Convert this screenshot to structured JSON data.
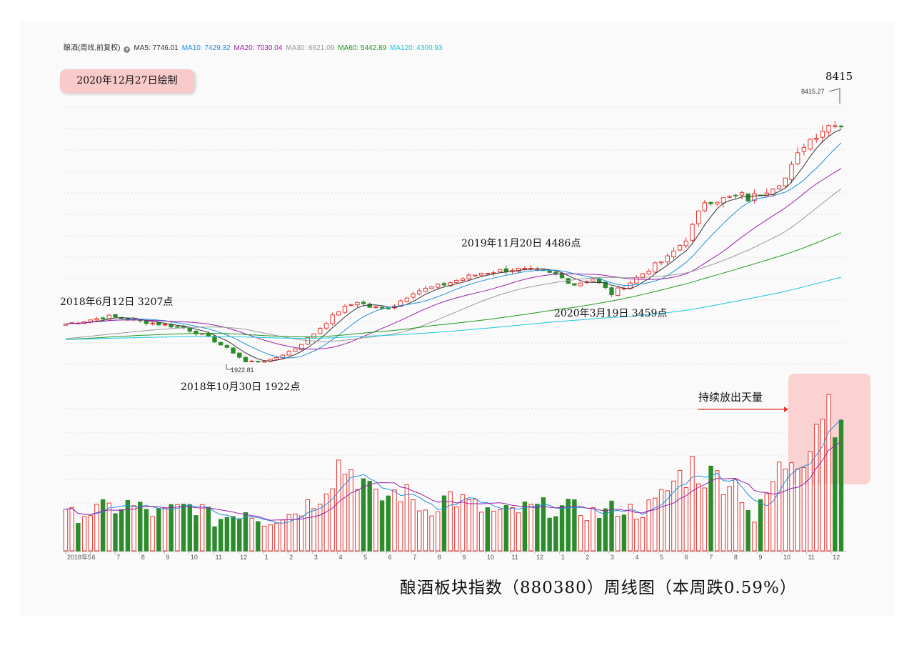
{
  "header": {
    "symbol": "酿酒(周线,前复权)",
    "ma5": "MA5: 7746.01",
    "ma10": "MA10: 7429.32",
    "ma20": "MA20: 7030.04",
    "ma30": "MA30: 6621.09",
    "ma60": "MA60: 5442.89",
    "ma120": "MA120: 4300.93"
  },
  "badge": "2020年12月27日绘制",
  "title": "酿酒板块指数（880380）周线图（本周跌0.59%）",
  "volume_note": "持续放出天量",
  "colors": {
    "up": "#e8332f",
    "down": "#2a8c2a",
    "ma5": "#333333",
    "ma10": "#1f8fe0",
    "ma20": "#9b1fa8",
    "ma30": "#999999",
    "ma60": "#1e9a1e",
    "ma120": "#19c8e0",
    "highlight": "#f9caca"
  },
  "chart_data": {
    "type": "candlestick",
    "ylim": [
      1600,
      8700
    ],
    "annotations": [
      {
        "text": "8415",
        "week": 112,
        "price": 8415
      },
      {
        "text": "8415.27",
        "week": 112,
        "price": 8415
      },
      {
        "text": "1922.81",
        "week": 29,
        "price": 1922
      },
      {
        "text": "2018年6月12日 3207点",
        "week": 7,
        "price": 3207
      },
      {
        "text": "2018年10月30日 1922点",
        "week": 29,
        "price": 1922
      },
      {
        "text": "2019年11月20日 4486点",
        "week": 73,
        "price": 4486
      },
      {
        "text": "2020年3月19日 3459点",
        "week": 89,
        "price": 3459
      }
    ],
    "month_labels": [
      "2018年5",
      "6",
      "7",
      "8",
      "9",
      "10",
      "11",
      "12",
      "1",
      "2",
      "3",
      "4",
      "5",
      "6",
      "7",
      "8",
      "9",
      "10",
      "11",
      "12",
      "1",
      "2",
      "3",
      "4",
      "5",
      "6",
      "7",
      "8",
      "9",
      "10",
      "11",
      "12"
    ],
    "weeks_total": 114,
    "close_anchors": [
      [
        0,
        2950
      ],
      [
        7,
        3150
      ],
      [
        13,
        3000
      ],
      [
        19,
        2850
      ],
      [
        23,
        2600
      ],
      [
        27,
        2200
      ],
      [
        29,
        1950
      ],
      [
        33,
        1990
      ],
      [
        37,
        2300
      ],
      [
        40,
        2700
      ],
      [
        44,
        3300
      ],
      [
        47,
        3550
      ],
      [
        49,
        3400
      ],
      [
        51,
        3350
      ],
      [
        53,
        3450
      ],
      [
        56,
        3800
      ],
      [
        60,
        3950
      ],
      [
        63,
        4100
      ],
      [
        67,
        4300
      ],
      [
        72,
        4400
      ],
      [
        76,
        4350
      ],
      [
        79,
        4250
      ],
      [
        82,
        4000
      ],
      [
        85,
        4150
      ],
      [
        88,
        3750
      ],
      [
        91,
        4050
      ],
      [
        94,
        4400
      ],
      [
        97,
        4700
      ],
      [
        100,
        5200
      ],
      [
        103,
        6200
      ],
      [
        106,
        6250
      ],
      [
        109,
        6350
      ],
      [
        110,
        6250
      ],
      [
        113,
        6500
      ],
      [
        116,
        6800
      ],
      [
        119,
        7700
      ],
      [
        122,
        8100
      ],
      [
        124,
        8300
      ],
      [
        125,
        8200
      ]
    ],
    "volume_anchors": [
      [
        0,
        1.5
      ],
      [
        6,
        1.8
      ],
      [
        10,
        2.0
      ],
      [
        15,
        1.6
      ],
      [
        21,
        2.0
      ],
      [
        24,
        1.3
      ],
      [
        29,
        1.8
      ],
      [
        32,
        1.3
      ],
      [
        36,
        1.6
      ],
      [
        40,
        2.2
      ],
      [
        42,
        3.0
      ],
      [
        44,
        3.8
      ],
      [
        47,
        3.4
      ],
      [
        50,
        2.2
      ],
      [
        54,
        2.6
      ],
      [
        58,
        1.8
      ],
      [
        62,
        2.4
      ],
      [
        66,
        1.9
      ],
      [
        70,
        1.6
      ],
      [
        74,
        1.8
      ],
      [
        78,
        1.9
      ],
      [
        82,
        1.8
      ],
      [
        86,
        1.6
      ],
      [
        89,
        1.9
      ],
      [
        92,
        1.7
      ],
      [
        95,
        2.0
      ],
      [
        98,
        3.0
      ],
      [
        101,
        3.7
      ],
      [
        104,
        3.2
      ],
      [
        107,
        3.3
      ],
      [
        109,
        2.6
      ],
      [
        111,
        1.3
      ],
      [
        114,
        3.0
      ],
      [
        117,
        4.3
      ],
      [
        119,
        4.5
      ],
      [
        122,
        6.5
      ]
    ]
  }
}
